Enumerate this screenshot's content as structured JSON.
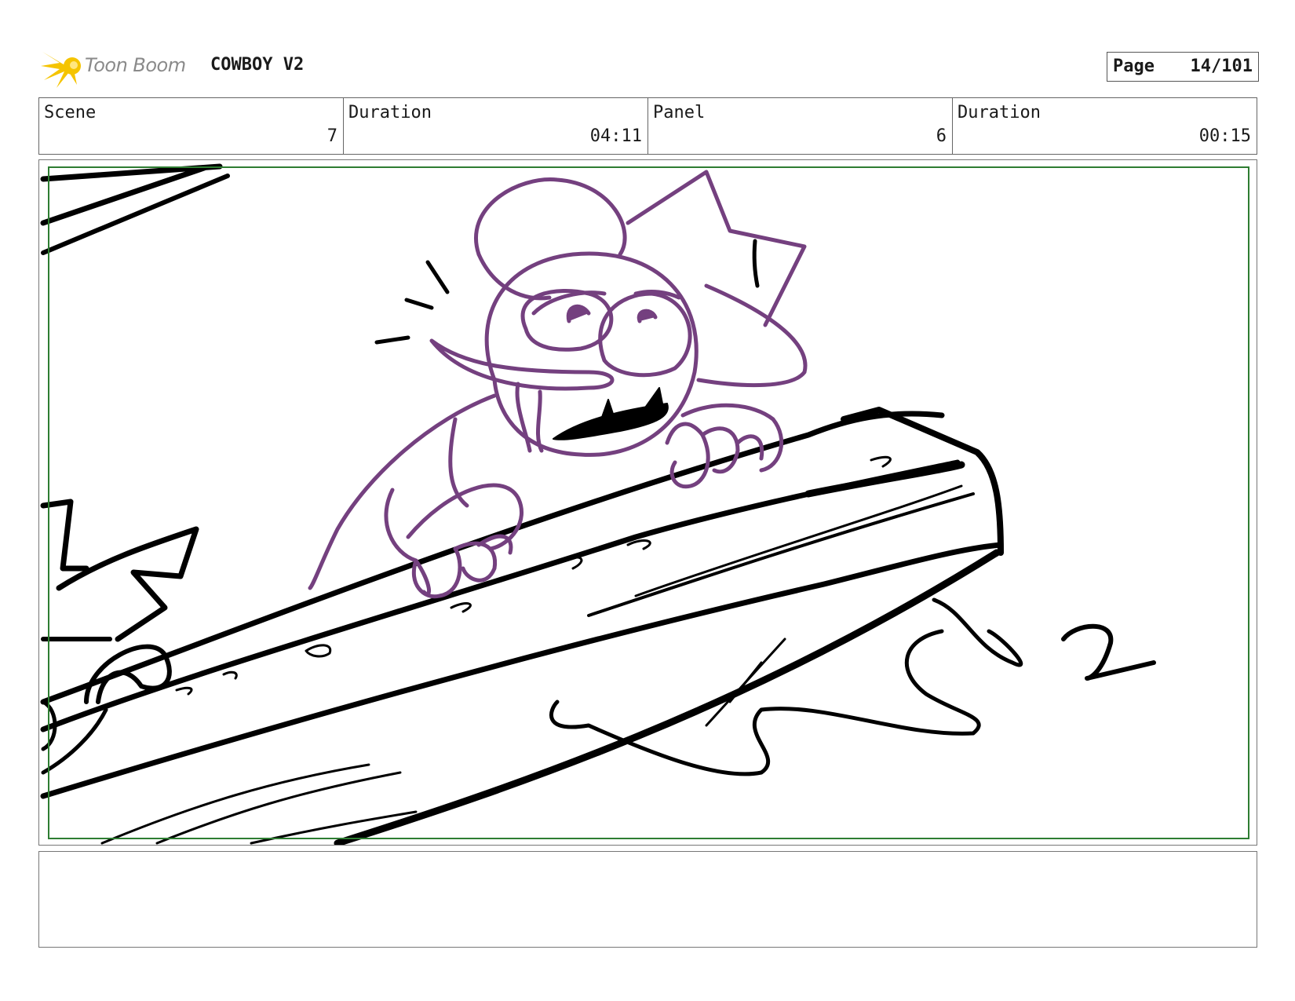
{
  "header": {
    "logo_text": "Toon Boom",
    "project_title": "COWBOY V2",
    "page_label": "Page",
    "page_value": "14/101"
  },
  "info": {
    "scene_label": "Scene",
    "scene_value": "7",
    "scene_duration_label": "Duration",
    "scene_duration_value": "04:11",
    "panel_label": "Panel",
    "panel_value": "6",
    "panel_duration_label": "Duration",
    "panel_duration_value": "00:15"
  },
  "panel": {
    "sketch_number": "2"
  },
  "colors": {
    "character_stroke": "#74407f",
    "ink_stroke": "#000000",
    "safe_frame": "#2e7d32",
    "logo_yellow": "#f5c400"
  },
  "icons": [
    "toon-boom-logo-icon"
  ]
}
